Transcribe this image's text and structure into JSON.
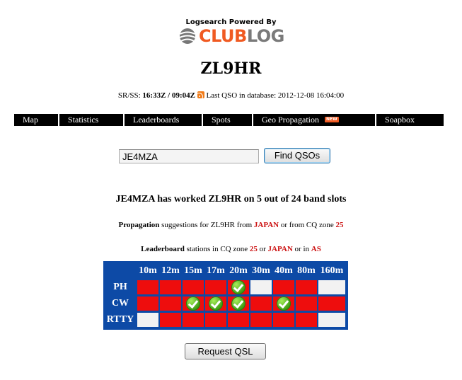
{
  "header": {
    "powered_by": "Logsearch Powered By",
    "logo_club": "CLUB",
    "logo_log": "LOG",
    "callsign": "ZL9HR"
  },
  "sun": {
    "label": "SR/SS:",
    "sunrise": "16:33Z",
    "separator": "/",
    "sunset": "09:04Z",
    "last_qso_label": "Last QSO in database:",
    "last_qso": "2012-12-08 16:04:00"
  },
  "nav": {
    "items": [
      {
        "label": "Map"
      },
      {
        "label": "Statistics"
      },
      {
        "label": "Leaderboards"
      },
      {
        "label": "Spots"
      },
      {
        "label": "Geo Propagation",
        "badge": "NEW"
      },
      {
        "label": "Soapbox"
      }
    ]
  },
  "search": {
    "value": "JE4MZA",
    "button": "Find QSOs"
  },
  "result": {
    "headline": "JE4MZA has worked ZL9HR on 5 out of 24 band slots"
  },
  "propagation": {
    "bold": "Propagation",
    "text1": "suggestions for ZL9HR from",
    "country": "JAPAN",
    "text2": "or from CQ zone",
    "zone": "25"
  },
  "leaderboard_line": {
    "bold": "Leaderboard",
    "text1": "stations in CQ zone",
    "zone": "25",
    "text2": "or",
    "country": "JAPAN",
    "text3": "or in",
    "continent": "AS"
  },
  "grid": {
    "bands": [
      "10m",
      "12m",
      "15m",
      "17m",
      "20m",
      "30m",
      "40m",
      "80m",
      "160m"
    ],
    "rows": [
      {
        "mode": "PH",
        "cells": [
          "needed",
          "needed",
          "needed",
          "needed",
          "worked",
          "na",
          "needed",
          "needed",
          "na"
        ]
      },
      {
        "mode": "CW",
        "cells": [
          "needed",
          "needed",
          "worked",
          "worked",
          "worked",
          "needed",
          "worked",
          "needed",
          "needed"
        ]
      },
      {
        "mode": "RTTY",
        "cells": [
          "na",
          "needed",
          "needed",
          "needed",
          "needed",
          "needed",
          "needed",
          "needed",
          "na"
        ]
      }
    ]
  },
  "qsl": {
    "button": "Request QSL"
  },
  "colors": {
    "needed": "#ee0d0d",
    "worked": "#3a9a10",
    "na": "#f2f2f2",
    "grid_bg": "#0d4aa6",
    "accent": "#f05a22"
  },
  "icons": {
    "rss": "rss-icon",
    "check": "check-icon",
    "logo": "clublog-ball-icon"
  }
}
